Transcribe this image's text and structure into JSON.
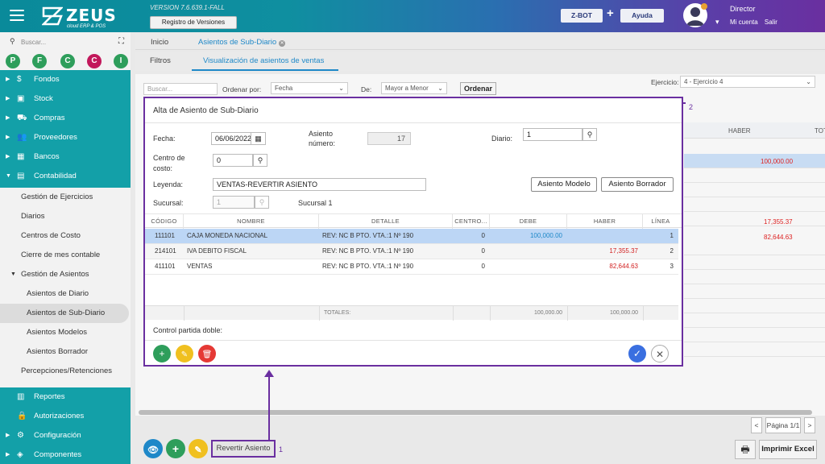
{
  "header": {
    "logo_text": "ZEUS",
    "logo_sub": "cloud ERP & POS",
    "version": "VERSION 7.6.639.1-FALL",
    "registro_button": "Registro de Versiones",
    "zbot_button": "Z-BOT",
    "plus": "+",
    "ayuda_button": "Ayuda",
    "user_name": "Director",
    "mi_cuenta": "Mi cuenta",
    "salir": "Salir"
  },
  "sidebar": {
    "search_placeholder": "Buscar...",
    "quick_buttons": [
      {
        "letter": "P",
        "color": "#2e9e5b"
      },
      {
        "letter": "F",
        "color": "#2e9e5b"
      },
      {
        "letter": "C",
        "color": "#2e9e5b"
      },
      {
        "letter": "C",
        "color": "#c2185b"
      },
      {
        "letter": "I",
        "color": "#2e9e5b"
      }
    ],
    "items_top": [
      {
        "label": "Fondos",
        "icon": "dollar-icon"
      },
      {
        "label": "Stock",
        "icon": "box-icon"
      },
      {
        "label": "Compras",
        "icon": "cart-icon"
      },
      {
        "label": "Proveedores",
        "icon": "people-icon"
      },
      {
        "label": "Bancos",
        "icon": "bank-icon"
      },
      {
        "label": "Contabilidad",
        "icon": "book-icon"
      }
    ],
    "sub_items": [
      "Gestión de Ejercicios",
      "Diarios",
      "Centros de Costo",
      "Cierre de mes contable",
      "Gestión de Asientos",
      "Asientos de Diario",
      "Asientos de Sub-Diario",
      "Asientos Modelos",
      "Asientos Borrador",
      "Percepciones/Retenciones"
    ],
    "items_bottom": [
      {
        "label": "Reportes",
        "icon": "report-icon"
      },
      {
        "label": "Autorizaciones",
        "icon": "lock-icon"
      },
      {
        "label": "Configuración",
        "icon": "gear-icon"
      },
      {
        "label": "Componentes",
        "icon": "cube-icon"
      }
    ]
  },
  "tabs": {
    "inicio": "Inicio",
    "asientos": "Asientos de Sub-Diario"
  },
  "subtabs": {
    "filtros": "Filtros",
    "visualizacion": "Visualización de asientos de ventas"
  },
  "filters": {
    "buscar_placeholder": "Buscar...",
    "ordenar_por_label": "Ordenar por:",
    "ordenar_por_value": "Fecha",
    "de_label": "De:",
    "de_value": "Mayor a Menor",
    "ordenar_button": "Ordenar",
    "ejercicio_label": "Ejercicio:",
    "ejercicio_value": "4 - Ejercicio 4"
  },
  "background_grid": {
    "haber_header": "HABER",
    "tot_header": "TOT",
    "values": [
      "100,000.00",
      "17,355.37",
      "82,644.63"
    ]
  },
  "modal": {
    "title": "Alta de Asiento de Sub-Diario",
    "fecha_label": "Fecha:",
    "fecha_value": "06/06/2022",
    "asiento_label_1": "Asiento",
    "asiento_label_2": "número:",
    "asiento_value": "17",
    "diario_label": "Diario:",
    "diario_value": "1",
    "centro_label_1": "Centro de",
    "centro_label_2": "costo:",
    "centro_value": "0",
    "leyenda_label": "Leyenda:",
    "leyenda_value": "VENTAS-REVERTIR ASIENTO",
    "asiento_modelo_button": "Asiento Modelo",
    "asiento_borrador_button": "Asiento Borrador",
    "sucursal_label": "Sucursal:",
    "sucursal_value": "1",
    "sucursal_name": "Sucursal 1",
    "grid_headers": [
      "CÓDIGO",
      "NOMBRE",
      "DETALLE",
      "CENTRO...",
      "DEBE",
      "HABER",
      "LÍNEA"
    ],
    "rows": [
      {
        "codigo": "111101",
        "nombre": "CAJA MONEDA NACIONAL",
        "detalle": "REV: NC B PTO. VTA.:1 Nº 190",
        "centro": "0",
        "debe": "100,000.00",
        "haber": "",
        "linea": "1"
      },
      {
        "codigo": "214101",
        "nombre": "IVA DEBITO FISCAL",
        "detalle": "REV: NC B PTO. VTA.:1 Nº 190",
        "centro": "0",
        "debe": "",
        "haber": "17,355.37",
        "linea": "2"
      },
      {
        "codigo": "411101",
        "nombre": "VENTAS",
        "detalle": "REV: NC B PTO. VTA.:1 Nº 190",
        "centro": "0",
        "debe": "",
        "haber": "82,644.63",
        "linea": "3"
      }
    ],
    "totales_label": "TOTALES:",
    "total_debe": "100,000.00",
    "total_haber": "100,000.00",
    "control_label": "Control partida doble:"
  },
  "bottom": {
    "revertir_button": "Revertir Asiento",
    "label_1": "1",
    "label_2": "2",
    "pager_prev": "<",
    "pager_text": "Página 1/1",
    "pager_next": ">",
    "imprimir_excel": "Imprimir Excel"
  },
  "colors": {
    "accent": "#13a0a8",
    "highlight": "#6a2fa0",
    "blue_link": "#1e88c8",
    "red_value": "#d22222"
  }
}
